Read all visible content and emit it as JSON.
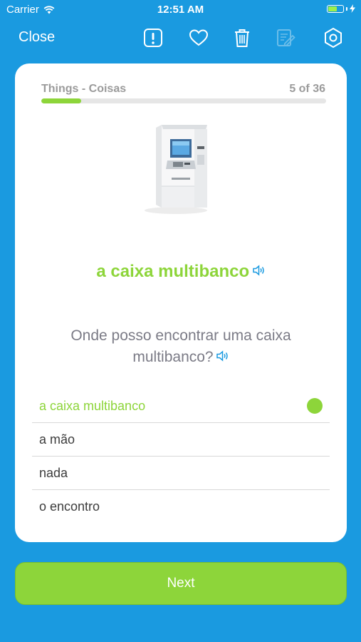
{
  "status_bar": {
    "carrier": "Carrier",
    "time": "12:51 AM"
  },
  "toolbar": {
    "close_label": "Close",
    "icons": [
      "report-icon",
      "heart-icon",
      "trash-icon",
      "edit-icon",
      "settings-icon"
    ]
  },
  "card": {
    "deck_name": "Things - Coisas",
    "progress_text": "5 of 36",
    "progress_fraction": 0.139,
    "word": "a caixa multibanco",
    "question": "Onde posso encontrar uma caixa multibanco?",
    "answers": [
      {
        "label": "a caixa multibanco",
        "state": "correct"
      },
      {
        "label": "a mão",
        "state": "none"
      },
      {
        "label": "nada",
        "state": "none"
      },
      {
        "label": "o encontro",
        "state": "none"
      }
    ]
  },
  "next_label": "Next",
  "colors": {
    "background": "#1a9ae0",
    "accent_green": "#8dd53a",
    "speaker_blue": "#1a9ae0"
  }
}
